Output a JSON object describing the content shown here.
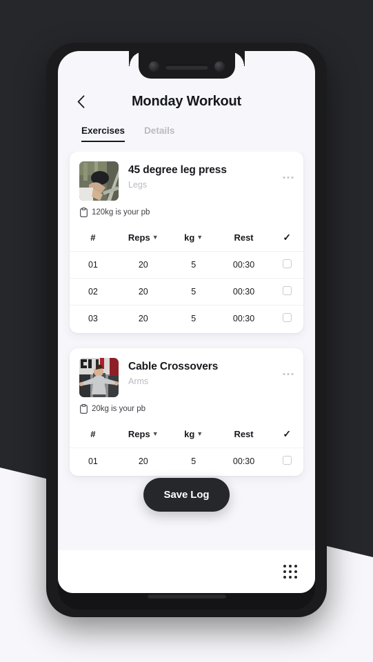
{
  "header": {
    "back_icon": "chevron-left-icon",
    "title": "Monday Workout"
  },
  "tabs": [
    {
      "label": "Exercises",
      "active": true
    },
    {
      "label": "Details",
      "active": false
    }
  ],
  "table_headers": {
    "number": "#",
    "reps": "Reps",
    "weight": "kg",
    "rest": "Rest",
    "check": "check-icon"
  },
  "exercises": [
    {
      "name": "45 degree leg press",
      "muscle_group": "Legs",
      "pb_icon": "clipboard-icon",
      "pb_text": "120kg is your pb",
      "more_icon": "ellipsis-icon",
      "sets": [
        {
          "number": "01",
          "reps": "20",
          "weight": "5",
          "rest": "00:30",
          "done": false
        },
        {
          "number": "02",
          "reps": "20",
          "weight": "5",
          "rest": "00:30",
          "done": false
        },
        {
          "number": "03",
          "reps": "20",
          "weight": "5",
          "rest": "00:30",
          "done": false
        }
      ]
    },
    {
      "name": "Cable Crossovers",
      "muscle_group": "Arms",
      "pb_icon": "clipboard-icon",
      "pb_text": "20kg is your pb",
      "more_icon": "ellipsis-icon",
      "sets": [
        {
          "number": "01",
          "reps": "20",
          "weight": "5",
          "rest": "00:30",
          "done": false
        }
      ]
    }
  ],
  "save_log_button": "Save Log",
  "bottom_bar": {
    "grid_icon": "apps-grid-icon"
  },
  "colors": {
    "background_dark": "#26272b",
    "background_light": "#f7f7fb",
    "card": "#ffffff",
    "text_primary": "#17181c",
    "text_muted": "#b9bac1",
    "accent_dark": "#26272b"
  }
}
